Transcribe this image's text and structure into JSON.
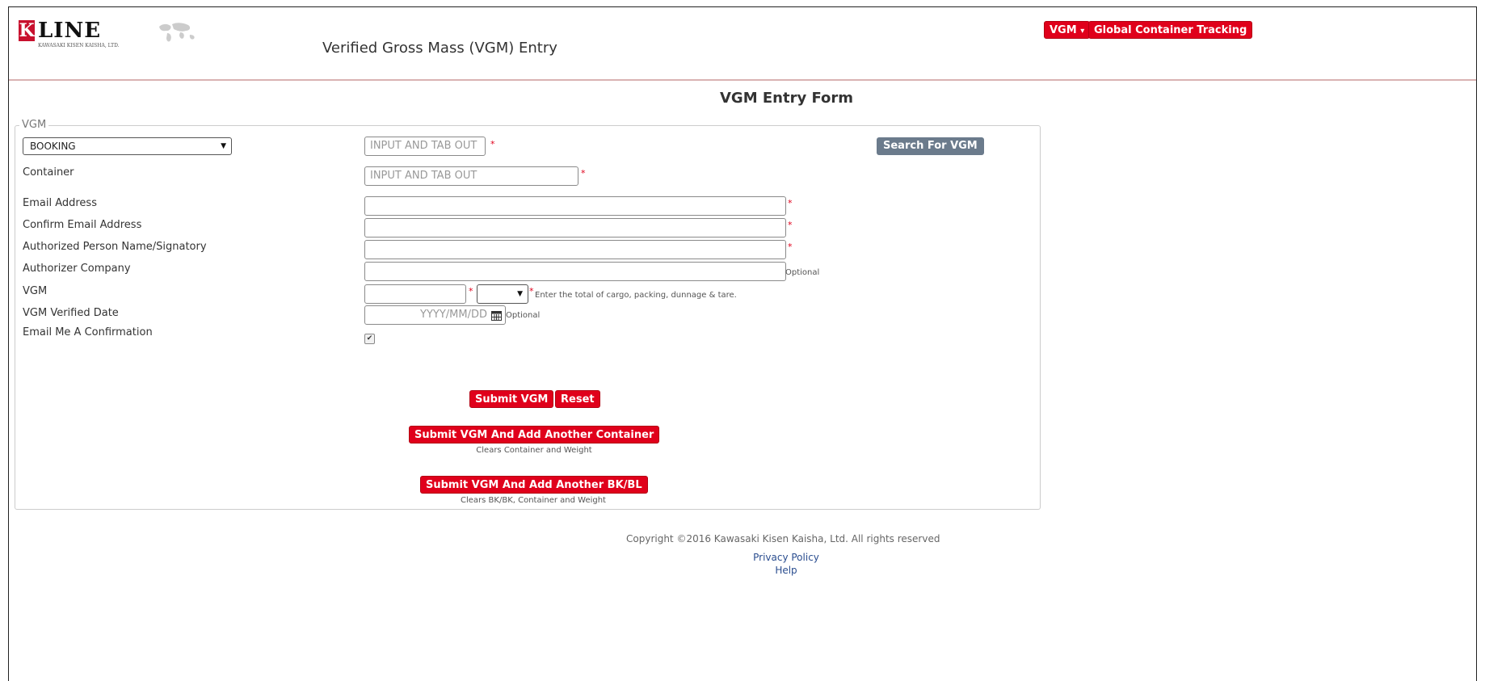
{
  "header": {
    "logo_mark": "K",
    "logo_text": "LINE",
    "logo_sub": "KAWASAKI KISEN KAISHA, LTD.",
    "page_title": "Verified Gross Mass (VGM) Entry",
    "nav_vgm_label": "VGM",
    "nav_vgm_caret": "▾",
    "nav_tracking_label": "Global Container Tracking"
  },
  "form": {
    "title": "VGM Entry Form",
    "legend": "VGM",
    "required_mark": "*",
    "search_type": {
      "selected": "BOOKING",
      "caret": "▼"
    },
    "search_input": {
      "placeholder": "INPUT AND TAB OUT",
      "value": ""
    },
    "search_button": "Search For VGM",
    "fields": {
      "container": {
        "label": "Container",
        "placeholder": "INPUT AND TAB OUT",
        "value": ""
      },
      "email": {
        "label": "Email Address",
        "value": ""
      },
      "confirm_email": {
        "label": "Confirm Email Address",
        "value": ""
      },
      "authorized_person": {
        "label": "Authorized Person Name/Signatory",
        "value": ""
      },
      "authorizer_company": {
        "label": "Authorizer Company",
        "value": "",
        "note": "Optional"
      },
      "vgm": {
        "label": "VGM",
        "value": "",
        "unit_selected": "",
        "unit_caret": "▼",
        "note": "Enter the total of cargo, packing, dunnage & tare."
      },
      "vgm_date": {
        "label": "VGM Verified Date",
        "placeholder": "YYYY/MM/DD",
        "note": "Optional",
        "icon": "calendar-icon"
      },
      "email_confirmation": {
        "label": "Email Me A Confirmation",
        "checked": true,
        "check_glyph": "✔"
      }
    },
    "actions": {
      "submit": "Submit VGM",
      "reset": "Reset",
      "submit_add_container": "Submit VGM And Add Another Container",
      "submit_add_container_note": "Clears Container and Weight",
      "submit_add_bkbl": "Submit VGM And Add Another BK/BL",
      "submit_add_bkbl_note": "Clears BK/BK, Container and Weight"
    }
  },
  "footer": {
    "copyright": "Copyright ©2016 Kawasaki Kisen Kaisha, Ltd. All rights reserved",
    "privacy": "Privacy Policy",
    "help": "Help"
  },
  "colors": {
    "accent_red": "#e0001b",
    "button_grey": "#6b7b8c",
    "link_blue": "#2a4d8f"
  }
}
